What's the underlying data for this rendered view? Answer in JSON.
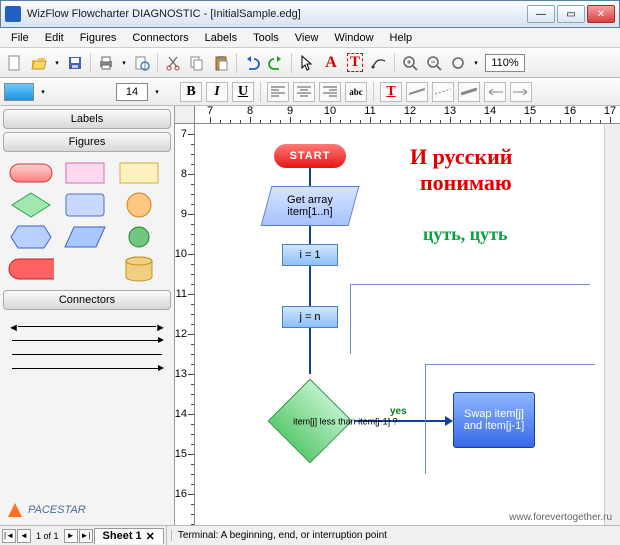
{
  "title": "WizFlow Flowcharter DIAGNOSTIC - [InitialSample.edg]",
  "menu": [
    "File",
    "Edit",
    "Figures",
    "Connectors",
    "Labels",
    "Tools",
    "View",
    "Window",
    "Help"
  ],
  "zoom": "110%",
  "font_size": "14",
  "fmt": {
    "bold": "B",
    "italic": "I",
    "underline": "U",
    "abc": "abc",
    "T": "T"
  },
  "sidebar": {
    "labels_hdr": "Labels",
    "figures_hdr": "Figures",
    "connectors_hdr": "Connectors"
  },
  "ruler_h": [
    "7",
    "8",
    "9",
    "10",
    "11",
    "12",
    "13",
    "14",
    "15",
    "16",
    "17"
  ],
  "ruler_v": [
    "7",
    "8",
    "9",
    "10",
    "11",
    "12",
    "13",
    "14",
    "15",
    "16"
  ],
  "flow": {
    "start": "START",
    "get_array": "Get array item[1..n]",
    "i1": "i = 1",
    "jn": "j = n",
    "cond": "item[j] less than item[j-1] ?",
    "yes": "yes",
    "swap": "Swap item[j] and item[j-1]"
  },
  "ru": {
    "line1": "И русский",
    "line2": "понимаю",
    "line3": "цуть, цуть"
  },
  "status": {
    "page": "1 of 1",
    "sheet": "Sheet 1",
    "desc": "Terminal: A beginning, end, or interruption point"
  },
  "logo": "PACESTAR",
  "watermark": "www.forevertogether.ru"
}
